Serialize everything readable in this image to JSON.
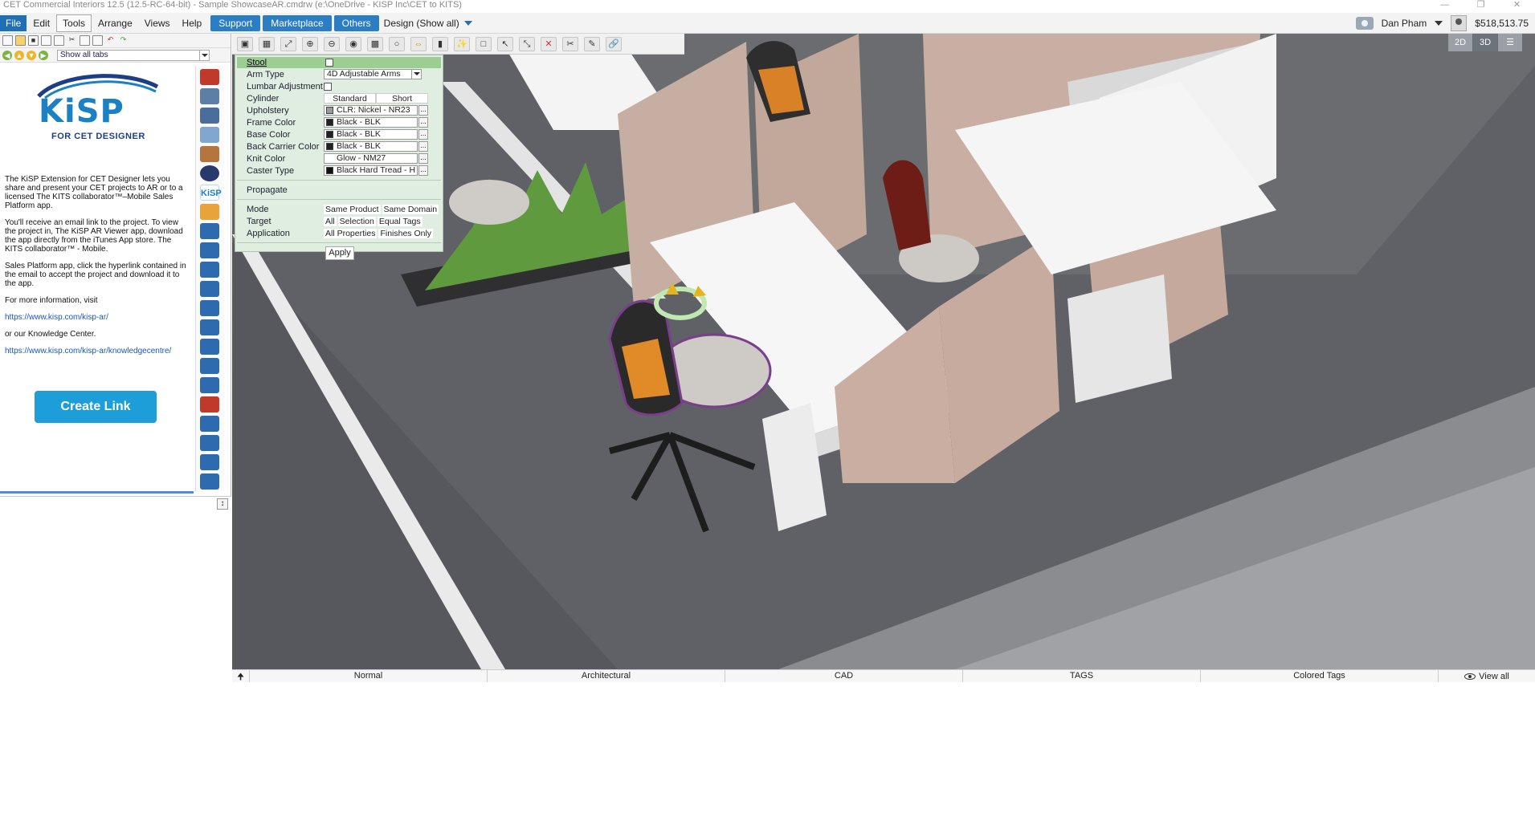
{
  "window": {
    "title": "CET Commercial Interiors 12.5 (12.5-RC-64-bit) - Sample ShowcaseAR.cmdrw (e:\\OneDrive - KISP Inc\\CET to KITS)"
  },
  "menubar": {
    "items": [
      "File",
      "Edit",
      "Tools",
      "Arrange",
      "Views",
      "Help"
    ],
    "blue_buttons": [
      "Support",
      "Marketplace",
      "Others"
    ],
    "design_dropdown": "Design (Show all)",
    "user_name": "Dan Pham",
    "price": "$518,513.75"
  },
  "left_panel": {
    "show_tabs_value": "Show all tabs",
    "logo_sub": "FOR CET DESIGNER",
    "logo_word": "KiSP",
    "paragraphs": [
      "The KiSP Extension for CET Designer lets you share and present your CET projects to AR or to a licensed The KITS collaborator™–Mobile Sales Platform app.",
      "You'll receive an email link to the project. To view the project in, The KiSP AR Viewer app, download the app directly from the iTunes App store. The KITS collaborator™ - Mobile.",
      "Sales Platform app, click the hyperlink contained in the email to accept the project and download it to the app.",
      "For more information, visit"
    ],
    "link1": "https://www.kisp.com/kisp-ar/",
    "or_text": "or our Knowledge Center.",
    "link2": "https://www.kisp.com/kisp-ar/knowledgecentre/",
    "create_link_label": "Create Link"
  },
  "viewport": {
    "view_2d": "2D",
    "view_3d": "3D",
    "active_view": "3D"
  },
  "properties": {
    "header": "Stool",
    "arm_type_label": "Arm Type",
    "arm_type_value": "4D Adjustable Arms",
    "lumbar_label": "Lumbar Adjustment",
    "cylinder_label": "Cylinder",
    "cylinder_options": [
      "Standard",
      "Short"
    ],
    "upholstery_label": "Upholstery",
    "upholstery_value": "CLR: Nickel - NR23",
    "frame_label": "Frame Color",
    "frame_value": "Black - BLK",
    "base_label": "Base Color",
    "base_value": "Black - BLK",
    "back_carrier_label": "Back Carrier Color",
    "back_carrier_value": "Black - BLK",
    "knit_label": "Knit Color",
    "knit_value": "Glow - NM27",
    "caster_label": "Caster Type",
    "caster_value": "Black Hard Tread - H",
    "propagate_label": "Propagate",
    "mode_label": "Mode",
    "mode_options": [
      "Same Product",
      "Same Domain"
    ],
    "target_label": "Target",
    "target_options": [
      "All",
      "Selection",
      "Equal Tags"
    ],
    "application_label": "Application",
    "application_options": [
      "All Properties",
      "Finishes Only"
    ],
    "apply_label": "Apply",
    "colors": {
      "upholstery": "#9a9a9a",
      "frame": "#222222",
      "base": "#222222",
      "back_carrier": "#222222",
      "knit": "#ffffff",
      "caster": "#111111"
    }
  },
  "statusbar": {
    "items": [
      "Normal",
      "Architectural",
      "CAD",
      "TAGS",
      "Colored Tags"
    ],
    "view_all": "View all"
  }
}
